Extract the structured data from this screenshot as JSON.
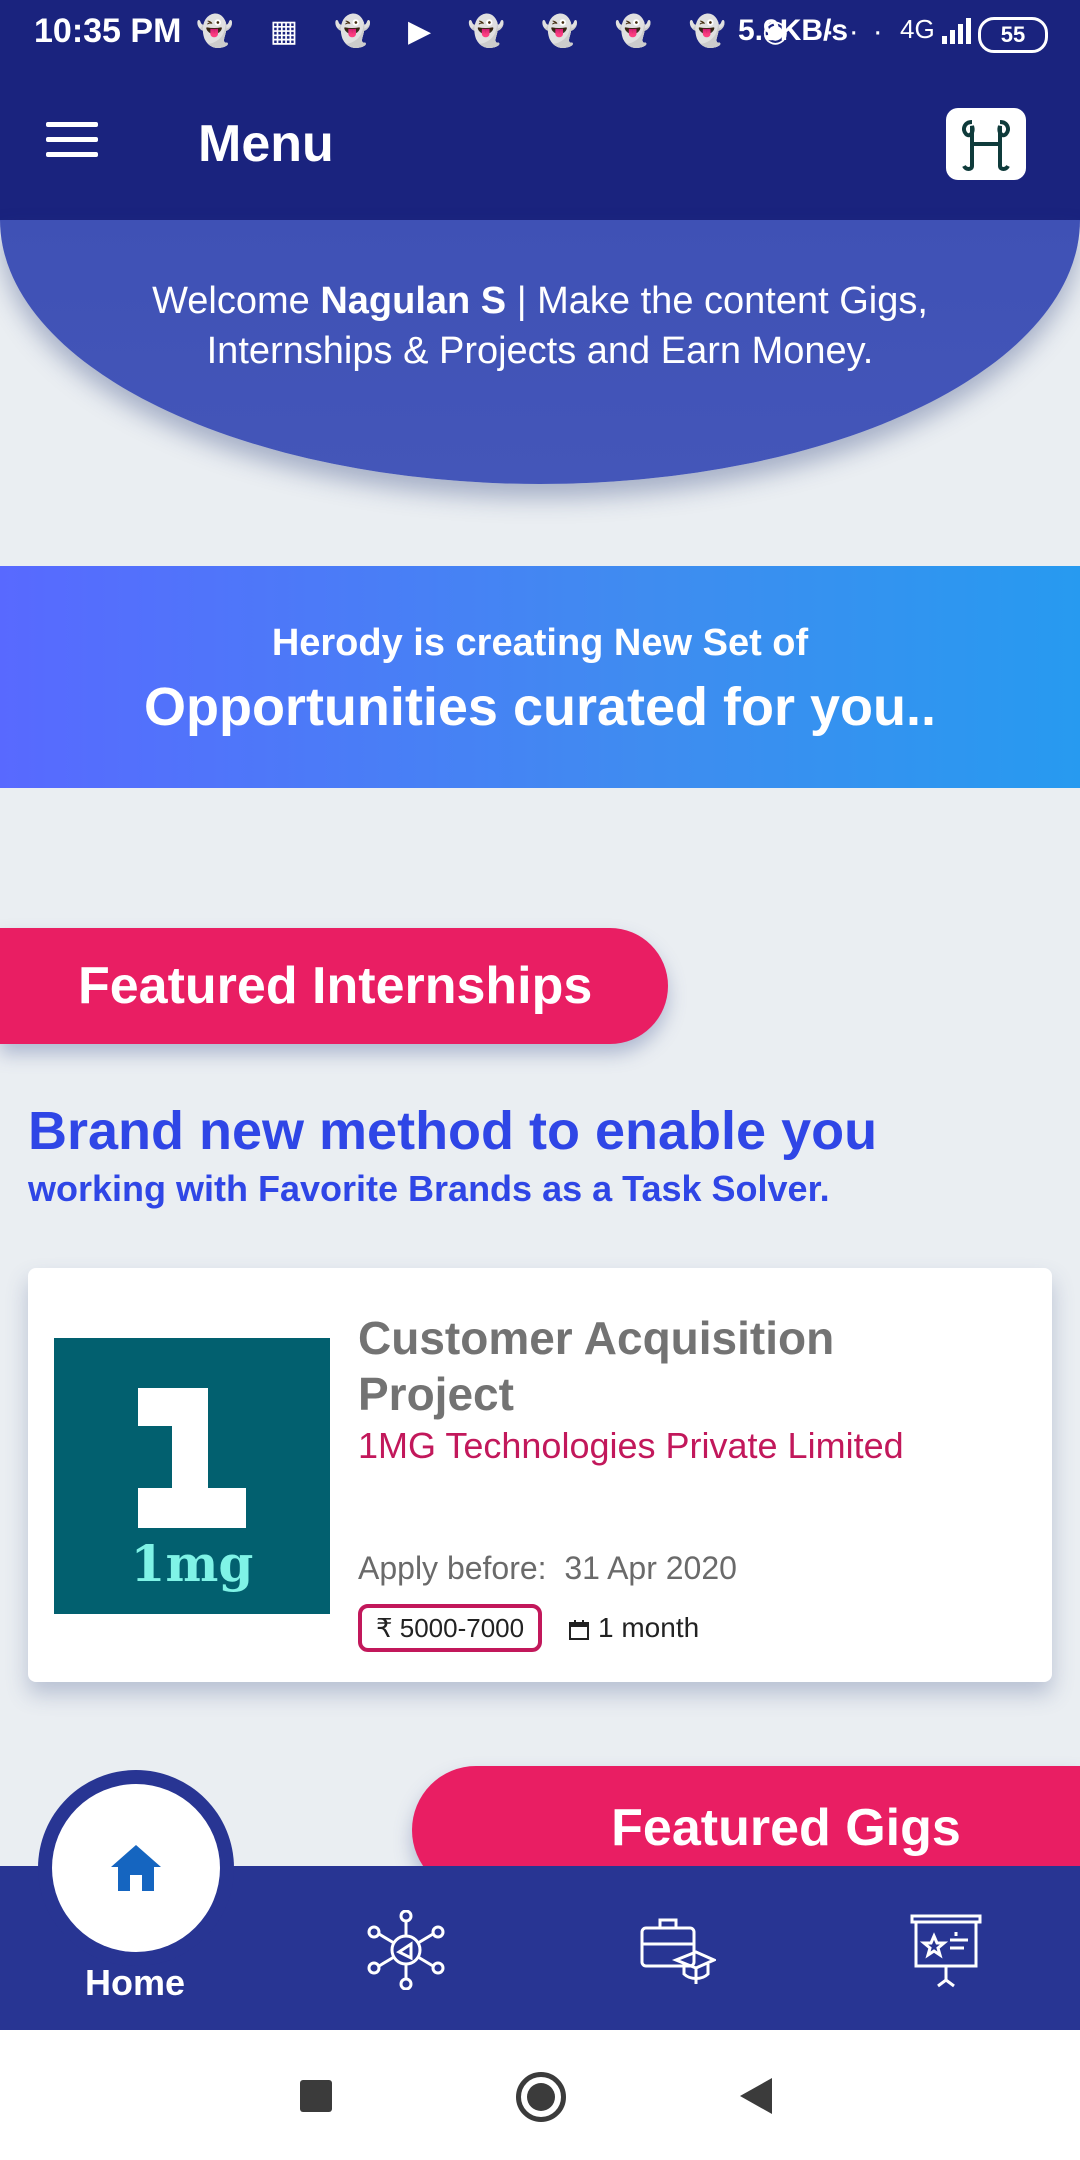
{
  "status_bar": {
    "time": "10:35 PM",
    "icons": "👻 ▦ 👻 ▶ 👻 👻 👻 👻 ◉  ···",
    "net_speed": "5.9KB/s",
    "signal": "4G",
    "battery": "55"
  },
  "app_bar": {
    "title": "Menu",
    "menu_icon": "hamburger-icon",
    "logo_icon": "herody-logo"
  },
  "welcome": {
    "prefix": "Welcome ",
    "user_name": "Nagulan S",
    "suffix": " | Make the content Gigs, Internships & Projects and Earn Money."
  },
  "opportunities_banner": {
    "line1": "Herody is creating New Set of",
    "line2": "Opportunities curated for you.."
  },
  "featured_internships": {
    "label": "Featured Internships",
    "tagline1": "Brand new method to enable you",
    "tagline2": "working with Favorite Brands as a Task Solver."
  },
  "internship_card": {
    "logo_text": "1mg",
    "title": "Customer Acquisition Project",
    "company": "1MG Technologies Private Limited",
    "apply_label": "Apply before:",
    "apply_date": "31 Apr 2020",
    "stipend": "₹ 5000-7000",
    "duration": "1 month"
  },
  "featured_gigs": {
    "label": "Featured Gigs"
  },
  "bottom_nav": {
    "home_label": "Home",
    "items": [
      "home-icon",
      "network-megaphone-icon",
      "briefcase-graduate-icon",
      "presentation-board-icon"
    ]
  },
  "colors": {
    "primary": "#1a237e",
    "nav": "#283593",
    "accent": "#e91e63",
    "brand_blue": "#2f46e6",
    "teal": "#02606f"
  }
}
